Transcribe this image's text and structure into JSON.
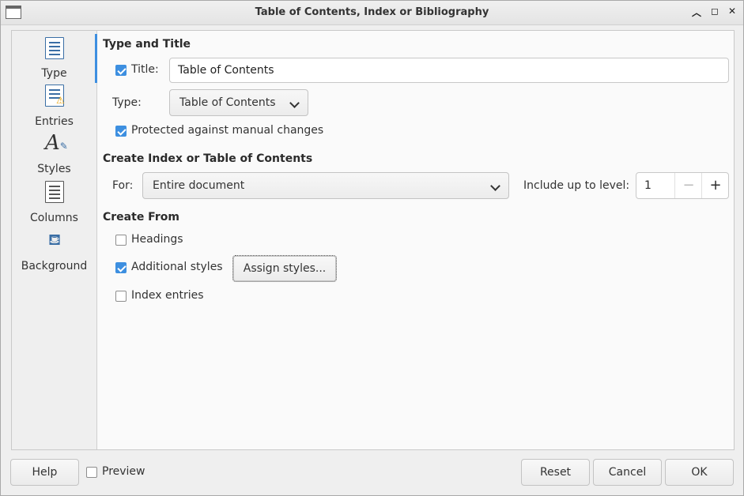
{
  "window": {
    "title": "Table of Contents, Index or Bibliography",
    "controls": [
      "minimize-icon",
      "maximize-icon",
      "close-icon"
    ]
  },
  "sidebar": {
    "items": [
      {
        "label": "Type",
        "icon": "document-lines-icon",
        "active": true
      },
      {
        "label": "Entries",
        "icon": "document-warning-icon"
      },
      {
        "label": "Styles",
        "icon": "italic-a-pen-icon"
      },
      {
        "label": "Columns",
        "icon": "columns-icon"
      },
      {
        "label": "Background",
        "icon": "paint-bucket-icon"
      }
    ]
  },
  "type_and_title": {
    "heading": "Type and Title",
    "title_label": "Title:",
    "title_checked": true,
    "title_value": "Table of Contents",
    "type_label": "Type:",
    "type_value": "Table of Contents",
    "protected_label": "Protected against manual changes",
    "protected_checked": true
  },
  "create_index": {
    "heading": "Create Index or Table of Contents",
    "for_label": "For:",
    "for_value": "Entire document",
    "level_label": "Include up to level:",
    "level_value": "1",
    "minus": "−",
    "plus": "+"
  },
  "create_from": {
    "heading": "Create From",
    "headings_label": "Headings",
    "headings_checked": false,
    "additional_label": "Additional styles",
    "additional_checked": true,
    "assign_button": "Assign styles...",
    "index_entries_label": "Index entries",
    "index_entries_checked": false
  },
  "footer": {
    "help": "Help",
    "preview_label": "Preview",
    "preview_checked": false,
    "reset": "Reset",
    "cancel": "Cancel",
    "ok": "OK"
  },
  "colors": {
    "accent": "#3d8fe0"
  }
}
